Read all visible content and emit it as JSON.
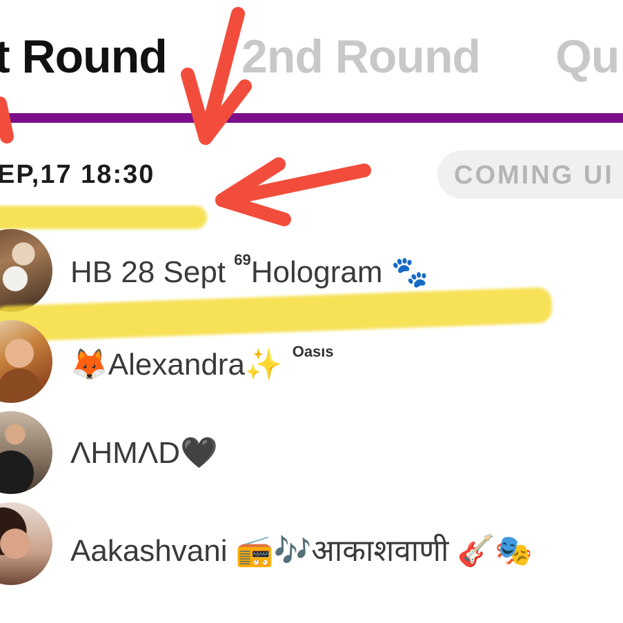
{
  "tabs": [
    {
      "label": "t Round",
      "active": true
    },
    {
      "label": "2nd Round",
      "active": false
    },
    {
      "label": "Qu",
      "active": false
    }
  ],
  "match": {
    "datetime": "EP,17 18:30",
    "status": "COMING UI"
  },
  "members": [
    {
      "name_prefix": "HB 28 Sept ",
      "sup": "69",
      "name_suffix": "Hologram 🐾",
      "tag": ""
    },
    {
      "name_prefix": "🦊Alexandra✨",
      "sup": "",
      "name_suffix": "",
      "tag": "Oasıs"
    },
    {
      "name_prefix": "ΛHMΛD🖤",
      "sup": "",
      "name_suffix": "",
      "tag": ""
    },
    {
      "name_prefix": "Aakashvani 📻🎶आकाशवाणी 🎸🎭",
      "sup": "",
      "name_suffix": "",
      "tag": ""
    }
  ],
  "colors": {
    "tab_underline": "#7b0f8a",
    "arrow": "#f24d3c",
    "highlight": "#f5dc3a"
  }
}
